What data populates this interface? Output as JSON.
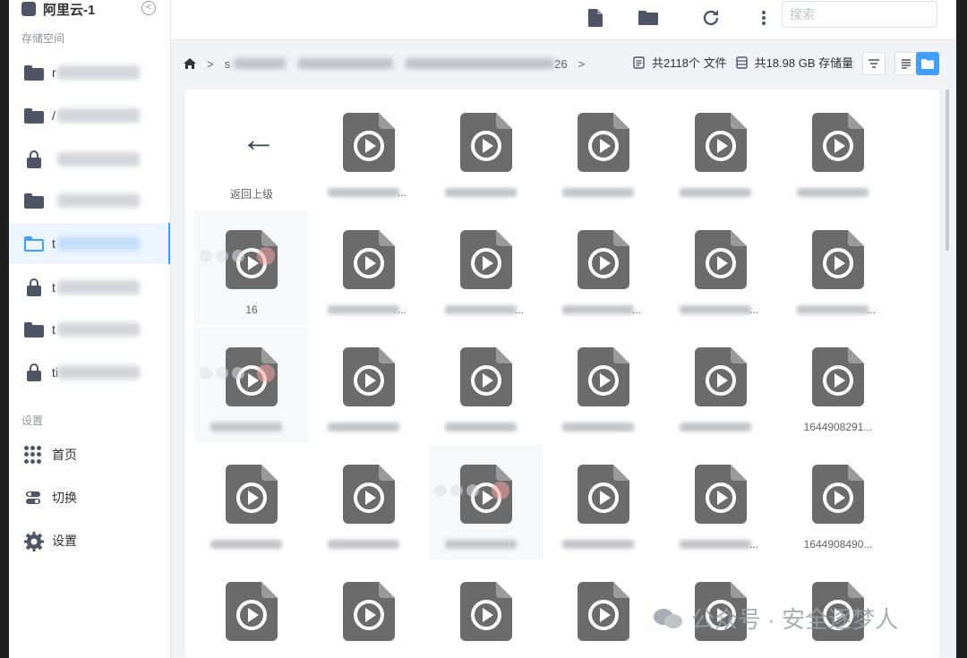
{
  "sidebar": {
    "title": "阿里云-1",
    "section_storage": "存储空间",
    "section_settings": "设置",
    "storages": [
      {
        "icon": "folder-icon",
        "label_visible": "r"
      },
      {
        "icon": "folder-icon",
        "label_visible": "/"
      },
      {
        "icon": "lock-icon",
        "label_visible": ""
      },
      {
        "icon": "folder-icon",
        "label_visible": ""
      },
      {
        "icon": "folder-open-icon",
        "label_visible": "t",
        "active": true
      },
      {
        "icon": "lock-icon",
        "label_visible": "t"
      },
      {
        "icon": "folder-icon",
        "label_visible": "t"
      },
      {
        "icon": "lock-icon",
        "label_visible": "ti"
      }
    ],
    "settings_items": [
      {
        "icon": "apps-grid-icon",
        "label": "首页"
      },
      {
        "icon": "switch-icon",
        "label": "切换"
      },
      {
        "icon": "gear-icon",
        "label": "设置"
      }
    ]
  },
  "toolbar": {
    "search_placeholder": "搜索",
    "buttons": [
      "new-file-icon",
      "new-folder-icon",
      "refresh-icon",
      "more-vertical-icon"
    ]
  },
  "breadcrumb": {
    "home_icon": "home-icon",
    "separator": ">",
    "first_visible": "s",
    "last_visible": "26"
  },
  "stats": {
    "files": "共2118个 文件",
    "storage": "共18.98 GB 存储量"
  },
  "view": {
    "mode": "grid"
  },
  "back_tile": {
    "label": "返回上级"
  },
  "files": [
    {
      "name": "",
      "suffix": "..."
    },
    {
      "name": "",
      "suffix": ""
    },
    {
      "name": "",
      "suffix": ""
    },
    {
      "name": "",
      "suffix": ""
    },
    {
      "name": "",
      "suffix": ""
    },
    {
      "name": "16",
      "suffix": "..."
    },
    {
      "name": "",
      "suffix": "..."
    },
    {
      "name": "",
      "suffix": "..."
    },
    {
      "name": "",
      "suffix": "..."
    },
    {
      "name": "",
      "suffix": "..."
    },
    {
      "name": "",
      "suffix": "..."
    },
    {
      "name": "",
      "suffix": ""
    },
    {
      "name": "",
      "suffix": ""
    },
    {
      "name": "",
      "suffix": ""
    },
    {
      "name": "",
      "suffix": ""
    },
    {
      "name": "",
      "suffix": ""
    },
    {
      "name": "1644908291...",
      "suffix": ""
    },
    {
      "name": "",
      "suffix": ""
    },
    {
      "name": "",
      "suffix": ""
    },
    {
      "name": "",
      "suffix": ""
    },
    {
      "name": "",
      "suffix": ""
    },
    {
      "name": "",
      "suffix": "..."
    },
    {
      "name": "1644908490...",
      "suffix": ""
    }
  ],
  "watermark": "公众号 · 安全逐梦人"
}
